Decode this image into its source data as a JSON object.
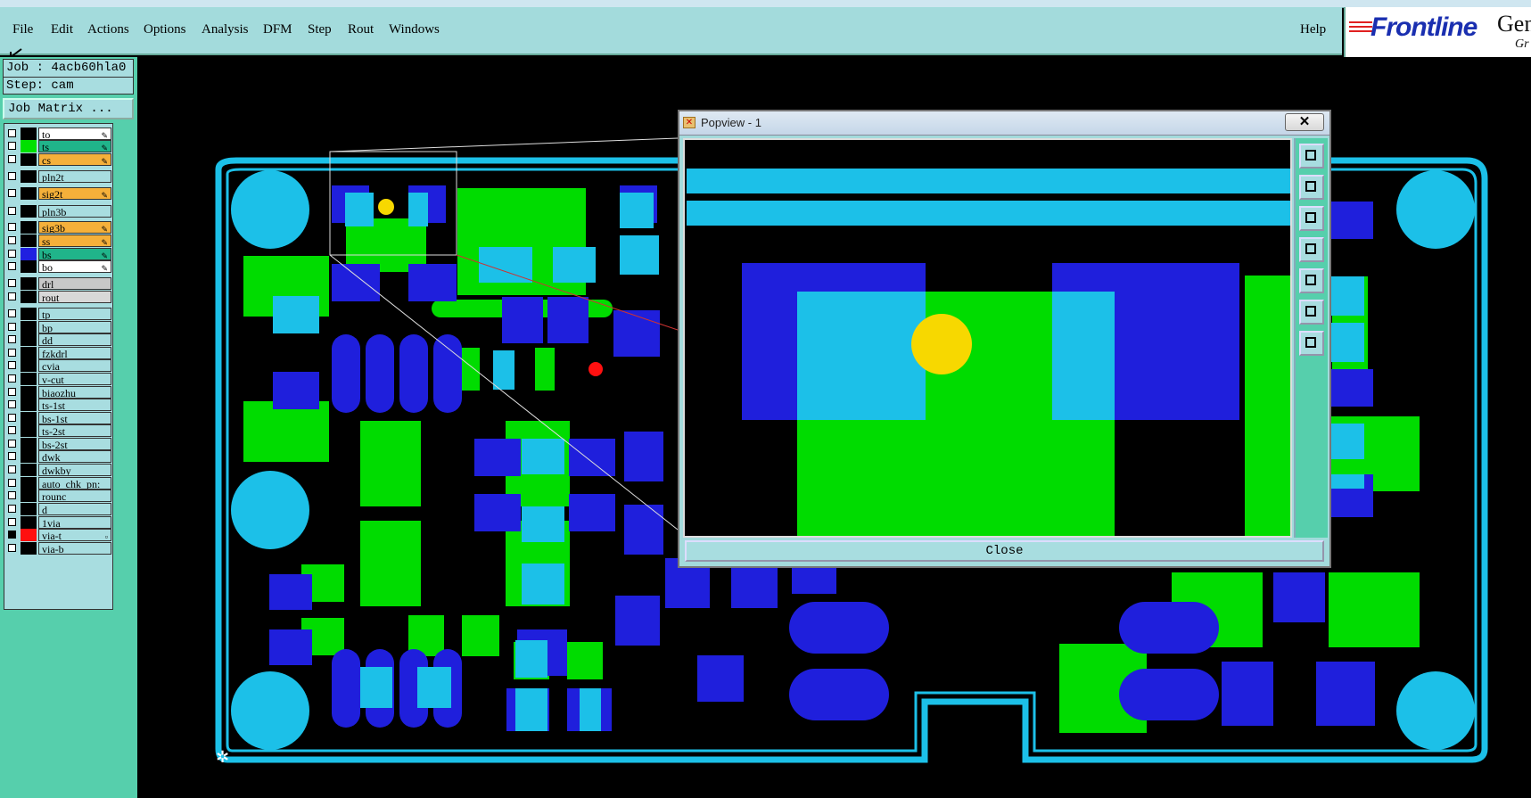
{
  "menu": {
    "file": "File",
    "edit": "Edit",
    "actions": "Actions",
    "options": "Options",
    "analysis": "Analysis",
    "dfm": "DFM",
    "step": "Step",
    "rout": "Rout",
    "windows": "Windows",
    "help": "Help"
  },
  "brand": {
    "logo": "Frontline",
    "product": "Gen",
    "sub": "Gr"
  },
  "job": {
    "job_label": "Job : 4acb60hla0",
    "step_label": "Step: cam",
    "matrix_button": "Job Matrix ..."
  },
  "layers": [
    {
      "name": "to",
      "color": "#ffffff",
      "swatch": "#000000",
      "checked": false
    },
    {
      "name": "ts",
      "color": "#20b48a",
      "swatch": "#00e000",
      "checked": false
    },
    {
      "name": "cs",
      "color": "#f5b03a",
      "swatch": "#000000",
      "checked": false
    },
    {
      "name": "pln2t",
      "color": "#a8dde0",
      "swatch": "#000000",
      "checked": false
    },
    {
      "name": "sig2t",
      "color": "#f5b03a",
      "swatch": "#000000",
      "checked": false
    },
    {
      "name": "pln3b",
      "color": "#a8dde0",
      "swatch": "#000000",
      "checked": false
    },
    {
      "name": "sig3b",
      "color": "#f5b03a",
      "swatch": "#000000",
      "checked": false
    },
    {
      "name": "ss",
      "color": "#f5b03a",
      "swatch": "#000000",
      "checked": false
    },
    {
      "name": "bs",
      "color": "#20b48a",
      "swatch": "#2020e0",
      "checked": false
    },
    {
      "name": "bo",
      "color": "#ffffff",
      "swatch": "#000000",
      "checked": false
    },
    {
      "name": "drl",
      "color": "#c8c8c8",
      "swatch": "#000000",
      "checked": false
    },
    {
      "name": "rout",
      "color": "#d8d8d8",
      "swatch": "#000000",
      "checked": false
    },
    {
      "name": "tp",
      "color": "#a8dde0",
      "swatch": "#000000",
      "checked": false
    },
    {
      "name": "bp",
      "color": "#a8dde0",
      "swatch": "#000000",
      "checked": false
    },
    {
      "name": "dd",
      "color": "#a8dde0",
      "swatch": "#000000",
      "checked": false
    },
    {
      "name": "fzkdrl",
      "color": "#a8dde0",
      "swatch": "#000000",
      "checked": false
    },
    {
      "name": "cvia",
      "color": "#a8dde0",
      "swatch": "#000000",
      "checked": false
    },
    {
      "name": "v-cut",
      "color": "#a8dde0",
      "swatch": "#000000",
      "checked": false
    },
    {
      "name": "biaozhu",
      "color": "#a8dde0",
      "swatch": "#000000",
      "checked": false
    },
    {
      "name": "ts-1st",
      "color": "#a8dde0",
      "swatch": "#000000",
      "checked": false
    },
    {
      "name": "bs-1st",
      "color": "#a8dde0",
      "swatch": "#000000",
      "checked": false
    },
    {
      "name": "ts-2st",
      "color": "#a8dde0",
      "swatch": "#000000",
      "checked": false
    },
    {
      "name": "bs-2st",
      "color": "#a8dde0",
      "swatch": "#000000",
      "checked": false
    },
    {
      "name": "dwk",
      "color": "#a8dde0",
      "swatch": "#000000",
      "checked": false
    },
    {
      "name": "dwkby",
      "color": "#a8dde0",
      "swatch": "#000000",
      "checked": false
    },
    {
      "name": "auto_chk_pn:",
      "color": "#a8dde0",
      "swatch": "#000000",
      "checked": false
    },
    {
      "name": "rounc",
      "color": "#a8dde0",
      "swatch": "#000000",
      "checked": false
    },
    {
      "name": "d",
      "color": "#a8dde0",
      "swatch": "#000000",
      "checked": false
    },
    {
      "name": "1via",
      "color": "#a8dde0",
      "swatch": "#000000",
      "checked": false
    },
    {
      "name": "via-t",
      "color": "#a8dde0",
      "swatch": "#ff1010",
      "checked": true
    },
    {
      "name": "via-b",
      "color": "#a8dde0",
      "swatch": "#000000",
      "checked": false
    }
  ],
  "popview": {
    "title": "Popview - 1",
    "close_label": "Close",
    "close_x": "✕"
  },
  "colors": {
    "light_blue": "#1cc0e8",
    "dark_blue": "#1f1fdc",
    "green": "#00dc00",
    "yellow": "#f7d800",
    "red": "#ff1010",
    "panel": "#56cfac",
    "menu": "#a3dbdc"
  }
}
